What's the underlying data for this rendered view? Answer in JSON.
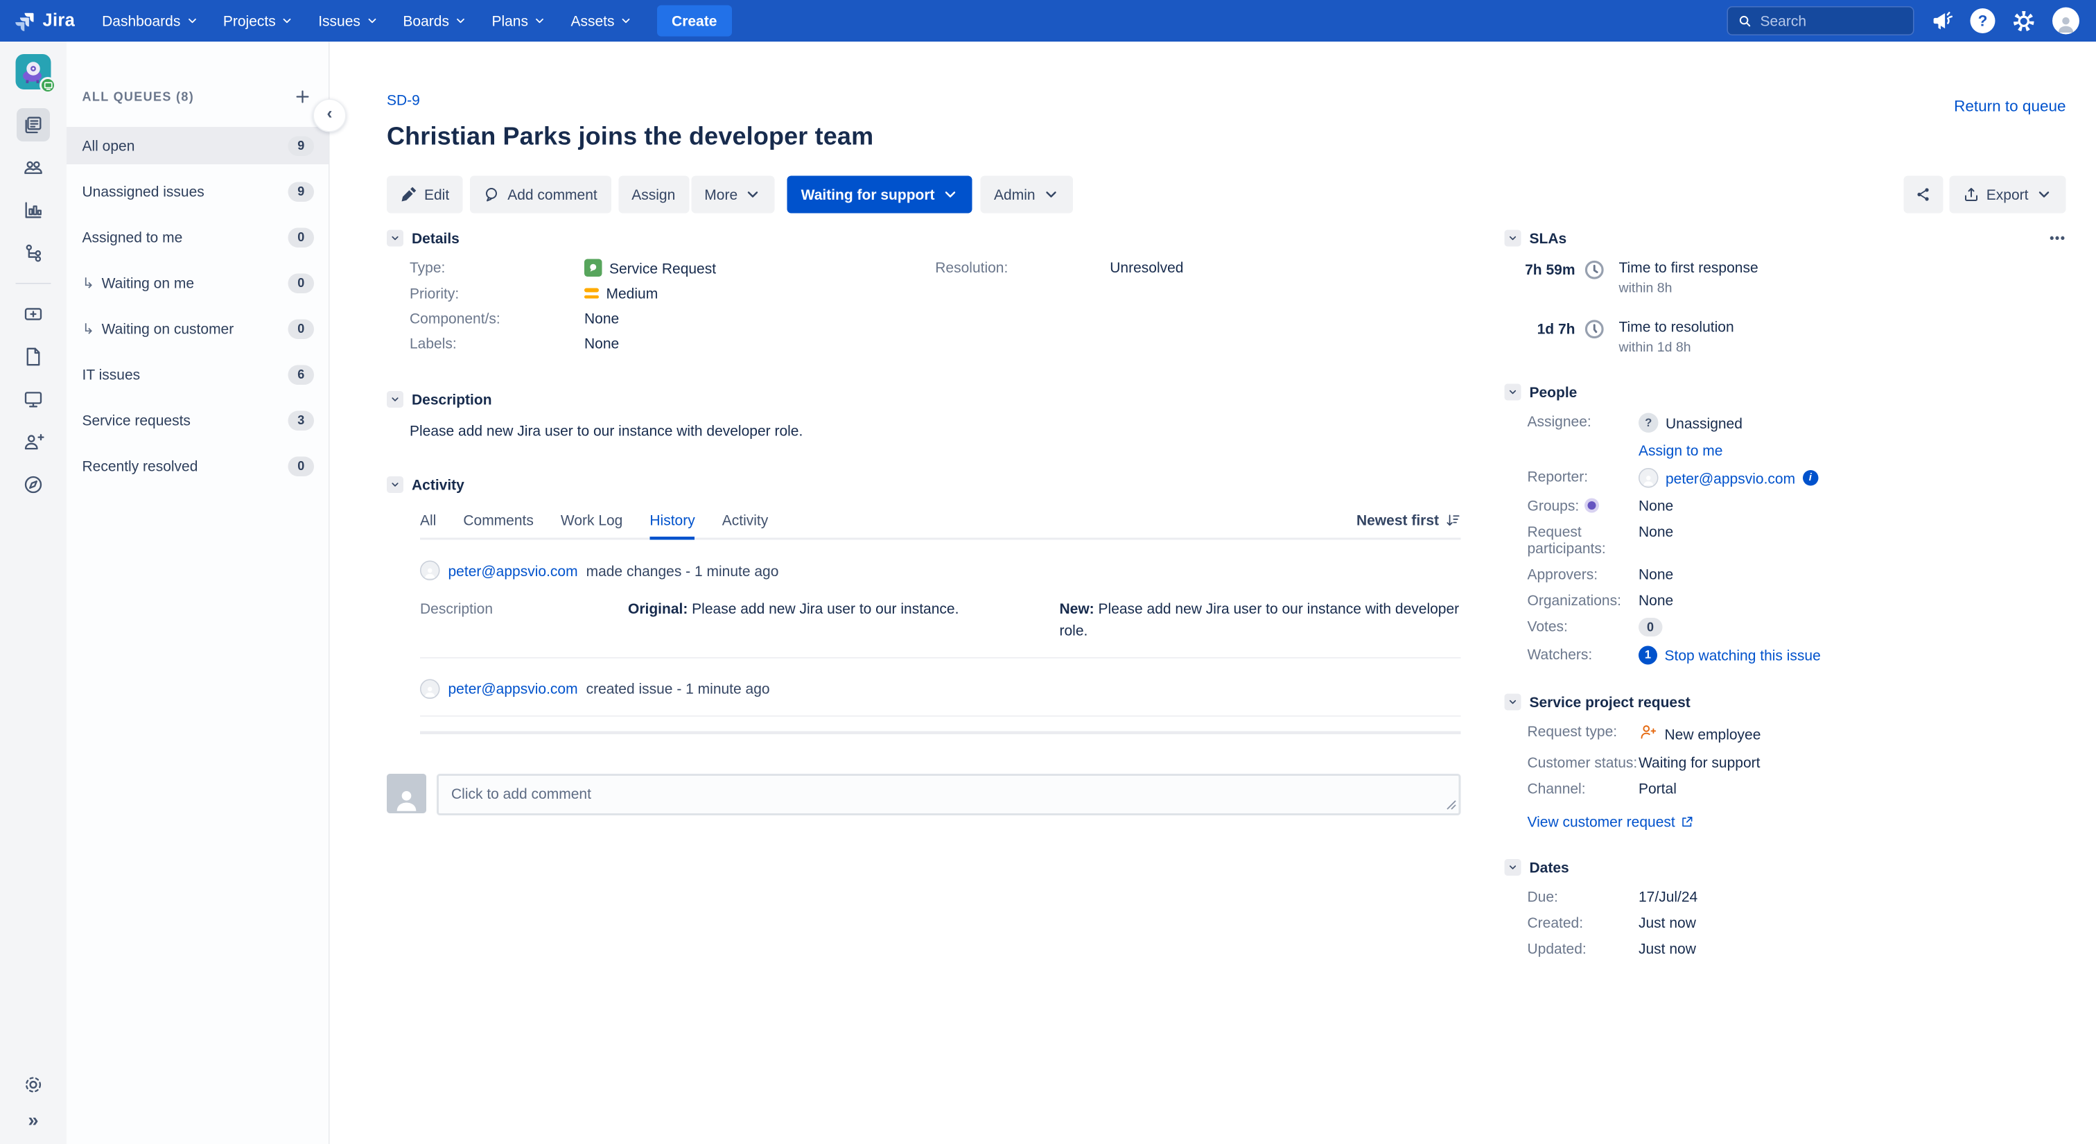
{
  "colors": {
    "navbar_blue": "#1B58C2",
    "create_blue": "#2271E8",
    "link_blue": "#0052CC",
    "text_dark": "#172B4D",
    "text_muted": "#6B778C",
    "button_gray": "#F1F2F4",
    "selected_row": "#EBECF0",
    "type_green": "#57A55C",
    "priority_orange": "#FFAB00",
    "request_orange": "#E56910",
    "groups_purple": "#6554C0"
  },
  "icons": {
    "indent": "↳",
    "ellipsis": "•••",
    "collapse_chevron": "‹",
    "expand_chevrons": "»",
    "question_mark": "?",
    "unassigned_mark": "?",
    "info": "i"
  },
  "topnav": {
    "brand": "Jira",
    "items": [
      "Dashboards",
      "Projects",
      "Issues",
      "Boards",
      "Plans",
      "Assets"
    ],
    "create_label": "Create",
    "search_placeholder": "Search"
  },
  "queues": {
    "header": "ALL QUEUES (8)",
    "items": [
      {
        "label": "All open",
        "count": "9"
      },
      {
        "label": "Unassigned issues",
        "count": "9"
      },
      {
        "label": "Assigned to me",
        "count": "0"
      },
      {
        "label": "Waiting on me",
        "count": "0"
      },
      {
        "label": "Waiting on customer",
        "count": "0"
      },
      {
        "label": "IT issues",
        "count": "6"
      },
      {
        "label": "Service requests",
        "count": "3"
      },
      {
        "label": "Recently resolved",
        "count": "0"
      }
    ]
  },
  "issue": {
    "key": "SD-9",
    "title": "Christian Parks joins the developer team",
    "return_link": "Return to queue",
    "toolbar": {
      "edit": "Edit",
      "add_comment": "Add comment",
      "assign": "Assign",
      "more": "More",
      "status": "Waiting for support",
      "admin": "Admin",
      "export": "Export"
    }
  },
  "details": {
    "heading": "Details",
    "type_label": "Type:",
    "type_value": "Service Request",
    "priority_label": "Priority:",
    "priority_value": "Medium",
    "component_label": "Component/s:",
    "component_value": "None",
    "labels_label": "Labels:",
    "labels_value": "None",
    "resolution_label": "Resolution:",
    "resolution_value": "Unresolved"
  },
  "description": {
    "heading": "Description",
    "text": "Please add new Jira user to our instance with developer role."
  },
  "activity": {
    "heading": "Activity",
    "tabs": [
      "All",
      "Comments",
      "Work Log",
      "History",
      "Activity"
    ],
    "active_tab": "History",
    "sort_label": "Newest first",
    "entries": [
      {
        "user": "peter@appsvio.com",
        "action": "made changes - 1 minute ago",
        "field": "Description",
        "original_label": "Original:",
        "original_text": "Please add new Jira user to our instance.",
        "new_label": "New:",
        "new_text": "Please add new Jira user to our instance with developer role."
      },
      {
        "user": "peter@appsvio.com",
        "action": "created issue - 1 minute ago"
      }
    ],
    "comment_placeholder": "Click to add comment"
  },
  "slas": {
    "heading": "SLAs",
    "rows": [
      {
        "value": "7h 59m",
        "title": "Time to first response",
        "goal": "within 8h"
      },
      {
        "value": "1d 7h",
        "title": "Time to resolution",
        "goal": "within 1d 8h"
      }
    ]
  },
  "people": {
    "heading": "People",
    "assignee_label": "Assignee:",
    "assignee_value": "Unassigned",
    "assign_to_me": "Assign to me",
    "reporter_label": "Reporter:",
    "reporter_value": "peter@appsvio.com",
    "groups_label": "Groups:",
    "groups_value": "None",
    "request_participants_label": "Request participants:",
    "request_participants_value": "None",
    "approvers_label": "Approvers:",
    "approvers_value": "None",
    "organizations_label": "Organizations:",
    "organizations_value": "None",
    "votes_label": "Votes:",
    "votes_value": "0",
    "watchers_label": "Watchers:",
    "watchers_count": "1",
    "watchers_action": "Stop watching this issue"
  },
  "service_request": {
    "heading": "Service project request",
    "request_type_label": "Request type:",
    "request_type_value": "New employee",
    "customer_status_label": "Customer status:",
    "customer_status_value": "Waiting for support",
    "channel_label": "Channel:",
    "channel_value": "Portal",
    "view_link": "View customer request"
  },
  "dates": {
    "heading": "Dates",
    "due_label": "Due:",
    "due_value": "17/Jul/24",
    "created_label": "Created:",
    "created_value": "Just now",
    "updated_label": "Updated:",
    "updated_value": "Just now"
  }
}
